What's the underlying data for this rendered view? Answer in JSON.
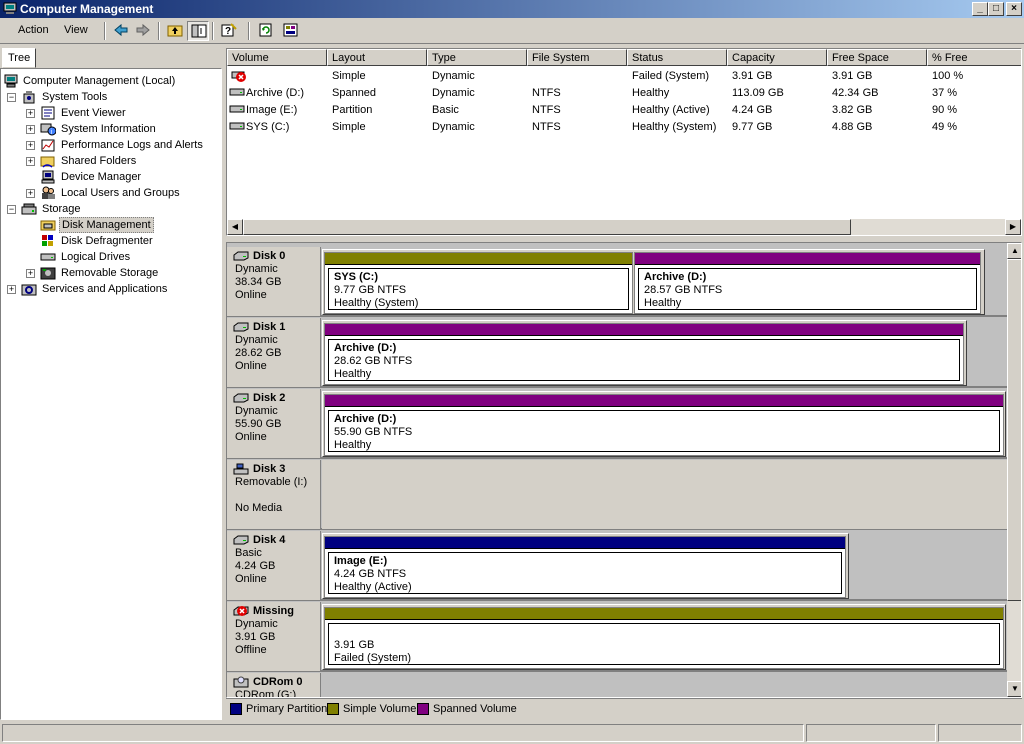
{
  "window": {
    "title": "Computer Management",
    "buttons": {
      "minimize": "_",
      "maximize": "□",
      "close": "×"
    }
  },
  "menu": {
    "action": "Action",
    "view": "View"
  },
  "tree": {
    "tab_label": "Tree",
    "root": "Computer Management (Local)",
    "system_tools": "System Tools",
    "event_viewer": "Event Viewer",
    "system_information": "System Information",
    "perf_logs": "Performance Logs and Alerts",
    "shared_folders": "Shared Folders",
    "device_manager": "Device Manager",
    "local_users": "Local Users and Groups",
    "storage": "Storage",
    "disk_management": "Disk Management",
    "disk_defragmenter": "Disk Defragmenter",
    "logical_drives": "Logical Drives",
    "removable_storage": "Removable Storage",
    "services_apps": "Services and Applications"
  },
  "volumes": {
    "columns": [
      "Volume",
      "Layout",
      "Type",
      "File System",
      "Status",
      "Capacity",
      "Free Space",
      "% Free"
    ],
    "rows": [
      {
        "volume": "",
        "layout": "Simple",
        "type": "Dynamic",
        "fs": "",
        "status": "Failed (System)",
        "capacity": "3.91 GB",
        "free": "3.91 GB",
        "pct": "100 %",
        "icon": "failed-volume-icon"
      },
      {
        "volume": "Archive (D:)",
        "layout": "Spanned",
        "type": "Dynamic",
        "fs": "NTFS",
        "status": "Healthy",
        "capacity": "113.09 GB",
        "free": "42.34 GB",
        "pct": "37 %",
        "icon": "volume-icon"
      },
      {
        "volume": "Image (E:)",
        "layout": "Partition",
        "type": "Basic",
        "fs": "NTFS",
        "status": "Healthy (Active)",
        "capacity": "4.24 GB",
        "free": "3.82 GB",
        "pct": "90 %",
        "icon": "volume-icon"
      },
      {
        "volume": "SYS (C:)",
        "layout": "Simple",
        "type": "Dynamic",
        "fs": "NTFS",
        "status": "Healthy (System)",
        "capacity": "9.77 GB",
        "free": "4.88 GB",
        "pct": "49 %",
        "icon": "volume-icon"
      }
    ]
  },
  "disks": {
    "d0": {
      "name": "Disk 0",
      "type": "Dynamic",
      "size": "38.34 GB",
      "state": "Online",
      "v0": {
        "name": "SYS  (C:)",
        "size": "9.77 GB NTFS",
        "status": "Healthy (System)"
      },
      "v1": {
        "name": "Archive  (D:)",
        "size": "28.57 GB NTFS",
        "status": "Healthy"
      }
    },
    "d1": {
      "name": "Disk 1",
      "type": "Dynamic",
      "size": "28.62 GB",
      "state": "Online",
      "v0": {
        "name": "Archive  (D:)",
        "size": "28.62 GB NTFS",
        "status": "Healthy"
      }
    },
    "d2": {
      "name": "Disk 2",
      "type": "Dynamic",
      "size": "55.90 GB",
      "state": "Online",
      "v0": {
        "name": "Archive  (D:)",
        "size": "55.90 GB NTFS",
        "status": "Healthy"
      }
    },
    "d3": {
      "name": "Disk 3",
      "type": "Removable (I:)",
      "state": "No Media"
    },
    "d4": {
      "name": "Disk 4",
      "type": "Basic",
      "size": "4.24 GB",
      "state": "Online",
      "v0": {
        "name": "Image  (E:)",
        "size": "4.24 GB NTFS",
        "status": "Healthy (Active)"
      }
    },
    "d5": {
      "name": "Missing",
      "type": "Dynamic",
      "size": "3.91 GB",
      "state": "Offline",
      "v0": {
        "name": "",
        "size": "3.91 GB",
        "status": "Failed (System)"
      }
    },
    "d6": {
      "name": "CDRom 0",
      "type": "CDRom (G:)"
    }
  },
  "legend": {
    "primary": "Primary Partition",
    "simple": "Simple Volume",
    "spanned": "Spanned Volume"
  },
  "colors": {
    "primary": "#000080",
    "simple": "#808000",
    "spanned": "#800080",
    "title_start": "#0a246a",
    "title_end": "#a6caf0"
  }
}
